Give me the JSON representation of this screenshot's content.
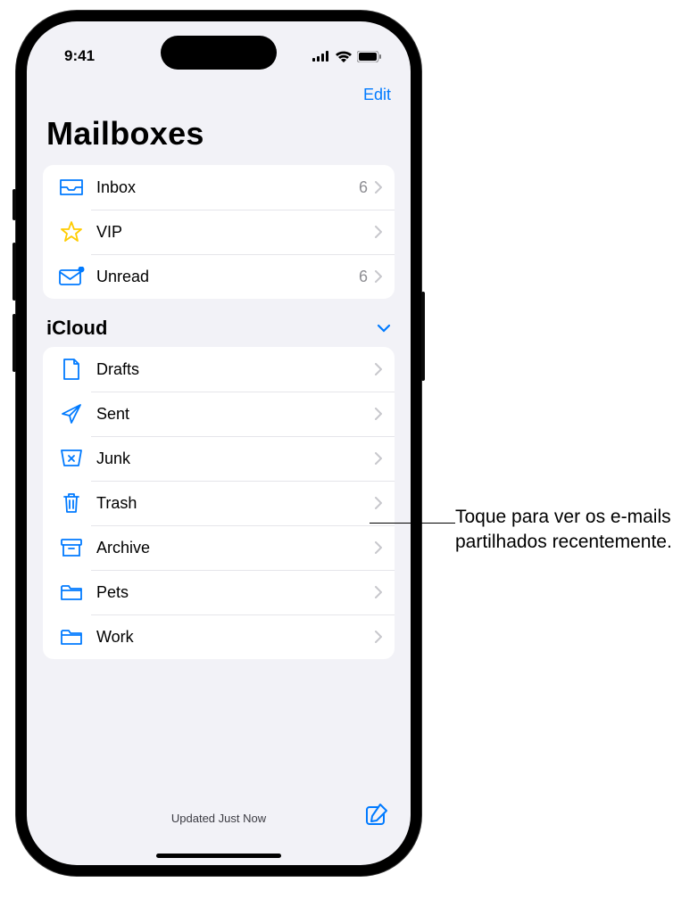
{
  "status": {
    "time": "9:41"
  },
  "nav": {
    "edit": "Edit"
  },
  "title": "Mailboxes",
  "favorites": [
    {
      "label": "Inbox",
      "count": "6",
      "icon": "inbox"
    },
    {
      "label": "VIP",
      "count": "",
      "icon": "star"
    },
    {
      "label": "Unread",
      "count": "6",
      "icon": "unread"
    }
  ],
  "section": {
    "title": "iCloud"
  },
  "icloud": [
    {
      "label": "Drafts",
      "icon": "draft"
    },
    {
      "label": "Sent",
      "icon": "sent"
    },
    {
      "label": "Junk",
      "icon": "junk"
    },
    {
      "label": "Trash",
      "icon": "trash"
    },
    {
      "label": "Archive",
      "icon": "archive"
    },
    {
      "label": "Pets",
      "icon": "folder"
    },
    {
      "label": "Work",
      "icon": "folder"
    }
  ],
  "bottom": {
    "status": "Updated Just Now"
  },
  "callout": "Toque para ver os e-mails partilhados recentemente."
}
